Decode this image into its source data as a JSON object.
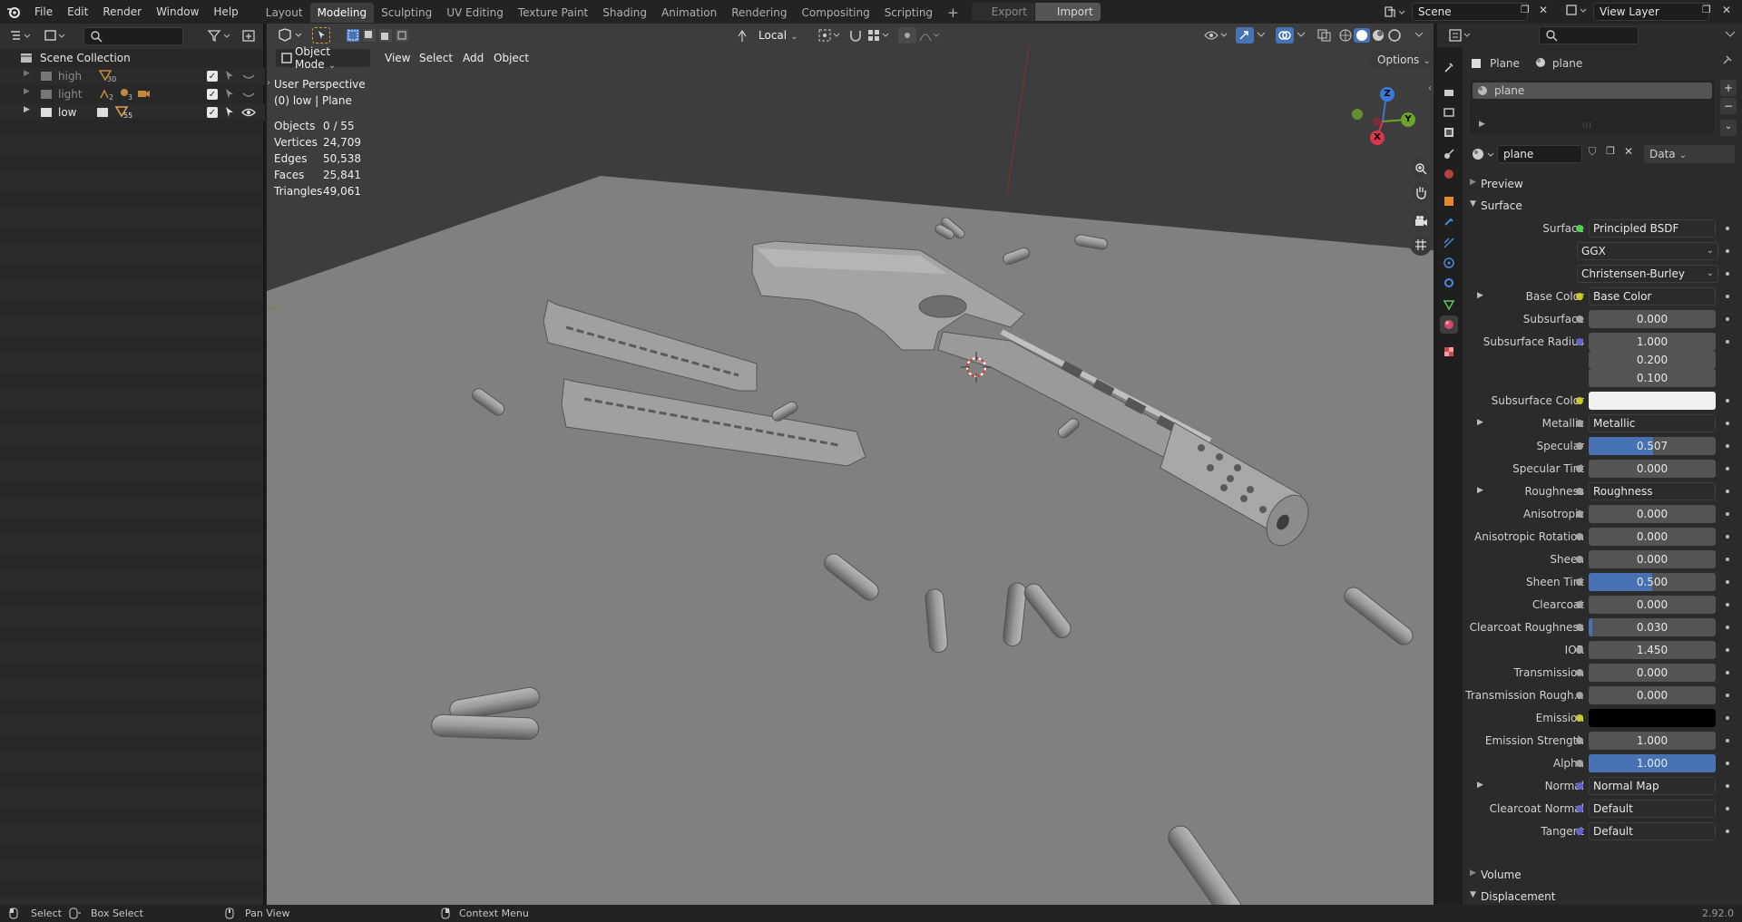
{
  "menubar": {
    "items": [
      "File",
      "Edit",
      "Render",
      "Window",
      "Help"
    ],
    "workspaces": [
      "Layout",
      "Modeling",
      "Sculpting",
      "UV Editing",
      "Texture Paint",
      "Shading",
      "Animation",
      "Rendering",
      "Compositing",
      "Scripting"
    ],
    "active_workspace": "Modeling",
    "add_tab": "+",
    "export_label": "Export",
    "import_label": "Import",
    "scene_name": "Scene",
    "view_layer": "View Layer"
  },
  "outliner": {
    "root": "Scene Collection",
    "collections": [
      {
        "name": "high",
        "count_a": "30",
        "count_b": ""
      },
      {
        "name": "light",
        "count_a": "2",
        "count_b": "3"
      },
      {
        "name": "low",
        "count_a": "",
        "count_b": "55"
      }
    ]
  },
  "viewport": {
    "mode": "Object Mode",
    "menus": [
      "View",
      "Select",
      "Add",
      "Object"
    ],
    "orientation": "Local",
    "options_label": "Options",
    "perspective": "User Perspective",
    "context": "(0) low | Plane",
    "stats": [
      {
        "label": "Objects",
        "value": "0 / 55"
      },
      {
        "label": "Vertices",
        "value": "24,709"
      },
      {
        "label": "Edges",
        "value": "50,538"
      },
      {
        "label": "Faces",
        "value": "25,841"
      },
      {
        "label": "Triangles",
        "value": "49,061"
      }
    ],
    "gizmo": {
      "x": "X",
      "y": "Y",
      "z": "Z"
    }
  },
  "properties": {
    "breadcrumb_object": "Plane",
    "breadcrumb_material": "plane",
    "slot_name": "plane",
    "material_name": "plane",
    "link_mode": "Data",
    "preview_label": "Preview",
    "surface_section": "Surface",
    "volume_section": "Volume",
    "displacement_section": "Displacement",
    "rows": [
      {
        "label": "Surface",
        "value": "Principled BSDF",
        "type": "link",
        "dot": "#4fcf4f"
      },
      {
        "label": "",
        "value": "GGX",
        "type": "enum",
        "dot": ""
      },
      {
        "label": "",
        "value": "Christensen-Burley",
        "type": "enum",
        "dot": ""
      },
      {
        "label": "Base Color",
        "value": "Base Color",
        "type": "link",
        "dot": "#c8c829",
        "expand": true
      },
      {
        "label": "Subsurface",
        "value": "0.000",
        "type": "num",
        "dot": "#a1a1a1",
        "fill": 0
      },
      {
        "label": "Subsurface Radius",
        "value": "1.000",
        "type": "vec",
        "dot": "#6363c7",
        "fill": 0
      },
      {
        "label": "",
        "value": "0.200",
        "type": "vec",
        "dot": "",
        "fill": 0
      },
      {
        "label": "",
        "value": "0.100",
        "type": "vec",
        "dot": "",
        "fill": 0
      },
      {
        "label": "Subsurface Color",
        "value": "",
        "type": "color",
        "dot": "#c8c829",
        "color": "#f0f0f0"
      },
      {
        "label": "Metallic",
        "value": "Metallic",
        "type": "link",
        "dot": "#a1a1a1",
        "expand": true
      },
      {
        "label": "Specular",
        "value": "0.507",
        "type": "num",
        "dot": "#a1a1a1",
        "fill": 0.507
      },
      {
        "label": "Specular Tint",
        "value": "0.000",
        "type": "num",
        "dot": "#a1a1a1",
        "fill": 0
      },
      {
        "label": "Roughness",
        "value": "Roughness",
        "type": "link",
        "dot": "#a1a1a1",
        "expand": true
      },
      {
        "label": "Anisotropic",
        "value": "0.000",
        "type": "num",
        "dot": "#a1a1a1",
        "fill": 0
      },
      {
        "label": "Anisotropic Rotation",
        "value": "0.000",
        "type": "num",
        "dot": "#a1a1a1",
        "fill": 0
      },
      {
        "label": "Sheen",
        "value": "0.000",
        "type": "num",
        "dot": "#a1a1a1",
        "fill": 0
      },
      {
        "label": "Sheen Tint",
        "value": "0.500",
        "type": "num",
        "dot": "#a1a1a1",
        "fill": 0.5
      },
      {
        "label": "Clearcoat",
        "value": "0.000",
        "type": "num",
        "dot": "#a1a1a1",
        "fill": 0
      },
      {
        "label": "Clearcoat Roughness",
        "value": "0.030",
        "type": "num",
        "dot": "#a1a1a1",
        "fill": 0.03
      },
      {
        "label": "IOR",
        "value": "1.450",
        "type": "num",
        "dot": "#a1a1a1",
        "fill": 0
      },
      {
        "label": "Transmission",
        "value": "0.000",
        "type": "num",
        "dot": "#a1a1a1",
        "fill": 0
      },
      {
        "label": "Transmission Rough...",
        "value": "0.000",
        "type": "num",
        "dot": "#a1a1a1",
        "fill": 0
      },
      {
        "label": "Emission",
        "value": "",
        "type": "color",
        "dot": "#c8c829",
        "color": "#000000"
      },
      {
        "label": "Emission Strength",
        "value": "1.000",
        "type": "num",
        "dot": "#a1a1a1",
        "fill": 0
      },
      {
        "label": "Alpha",
        "value": "1.000",
        "type": "num",
        "dot": "#a1a1a1",
        "fill": 1
      },
      {
        "label": "Normal",
        "value": "Normal Map",
        "type": "link",
        "dot": "#6363c7",
        "expand": true
      },
      {
        "label": "Clearcoat Normal",
        "value": "Default",
        "type": "link",
        "dot": "#6363c7"
      },
      {
        "label": "Tangent",
        "value": "Default",
        "type": "link",
        "dot": "#6363c7"
      }
    ]
  },
  "statusbar": {
    "select": "Select",
    "box_select": "Box Select",
    "pan_view": "Pan View",
    "context_menu": "Context Menu",
    "version": "2.92.0"
  },
  "colors": {
    "accent": "#4772b3",
    "active_tab": "#3d3d3d"
  }
}
